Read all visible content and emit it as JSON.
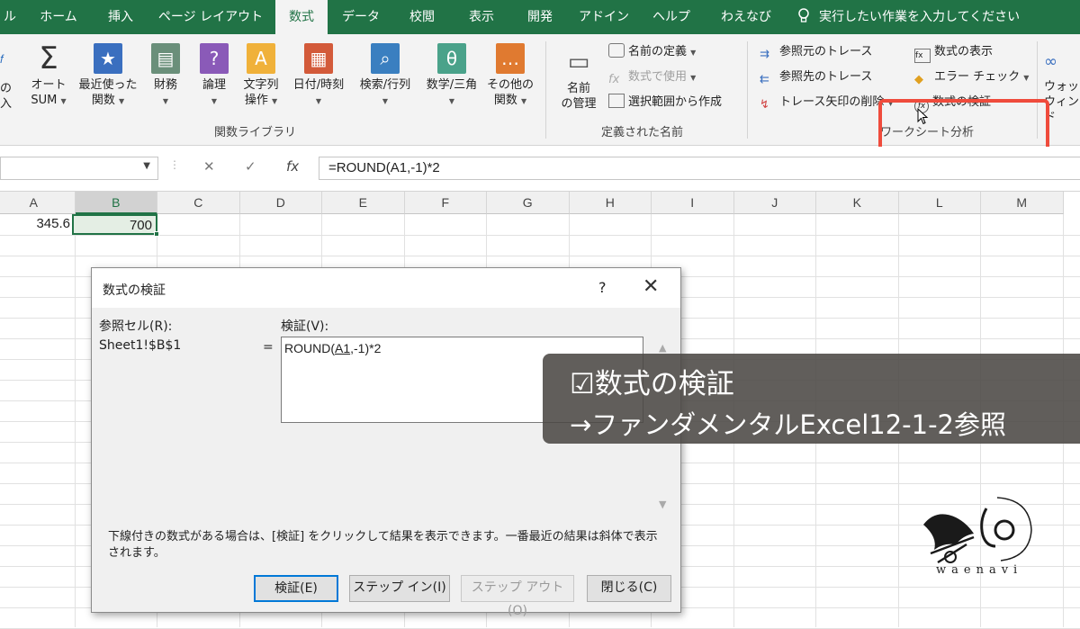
{
  "ribbon_tabs": [
    "ル",
    "ホーム",
    "挿入",
    "ページ レイアウト",
    "数式",
    "データ",
    "校閲",
    "表示",
    "開発",
    "アドイン",
    "ヘルプ",
    "わえなび",
    "実行したい作業を入力してください"
  ],
  "ribbon": {
    "left_edge": [
      "の",
      "入"
    ],
    "autosum": [
      "オート",
      "SUM"
    ],
    "recent": [
      "最近使った",
      "関数"
    ],
    "finance": "財務",
    "logic": "論理",
    "text": [
      "文字列",
      "操作"
    ],
    "datetime": "日付/時刻",
    "lookup": "検索/行列",
    "math": "数学/三角",
    "other": [
      "その他の",
      "関数"
    ],
    "group_library": "関数ライブラリ",
    "name_manager": [
      "名前",
      "の管理"
    ],
    "define_name": "名前の定義",
    "use_in_formula": "数式で使用",
    "create_from_sel": "選択範囲から作成",
    "group_names": "定義された名前",
    "trace_prec": "参照元のトレース",
    "trace_dep": "参照先のトレース",
    "remove_arrows": "トレース矢印の削除",
    "show_formulas": "数式の表示",
    "error_check": "エラー チェック",
    "evaluate": "数式の検証",
    "group_audit": "ワークシート分析",
    "watch": [
      "ウォッ",
      "ウィンド"
    ]
  },
  "formula_bar": {
    "cancel": "✕",
    "enter": "✓",
    "fx": "fx",
    "formula": "=ROUND(A1,-1)*2"
  },
  "columns": [
    "A",
    "B",
    "C",
    "D",
    "E",
    "F",
    "G",
    "H",
    "I",
    "J",
    "K",
    "L",
    "M"
  ],
  "cells": {
    "A1": "345.6",
    "B1": "700"
  },
  "dialog": {
    "title": "数式の検証",
    "help": "?",
    "close": "✕",
    "ref_label": "参照セル(R):",
    "ref_value": "Sheet1!$B$1",
    "eval_label": "検証(V):",
    "equals": "=",
    "expr_pre": "ROUND(",
    "expr_u": "A1",
    "expr_post": ",-1)*2",
    "note": "下線付きの数式がある場合は、[検証] をクリックして結果を表示できます。一番最近の結果は斜体で表示されます。",
    "btn_evaluate": "検証(E)",
    "btn_step_in": "ステップ イン(I)",
    "btn_step_out": "ステップ アウト(O)",
    "btn_close": "閉じる(C)"
  },
  "caption": {
    "line1": "☑数式の検証",
    "line2": "→ファンダメンタルExcel12-1-2参照"
  },
  "logo": {
    "text": "waenavi"
  },
  "colors": {
    "excel_green": "#217346",
    "highlight": "#ef4b3c"
  }
}
